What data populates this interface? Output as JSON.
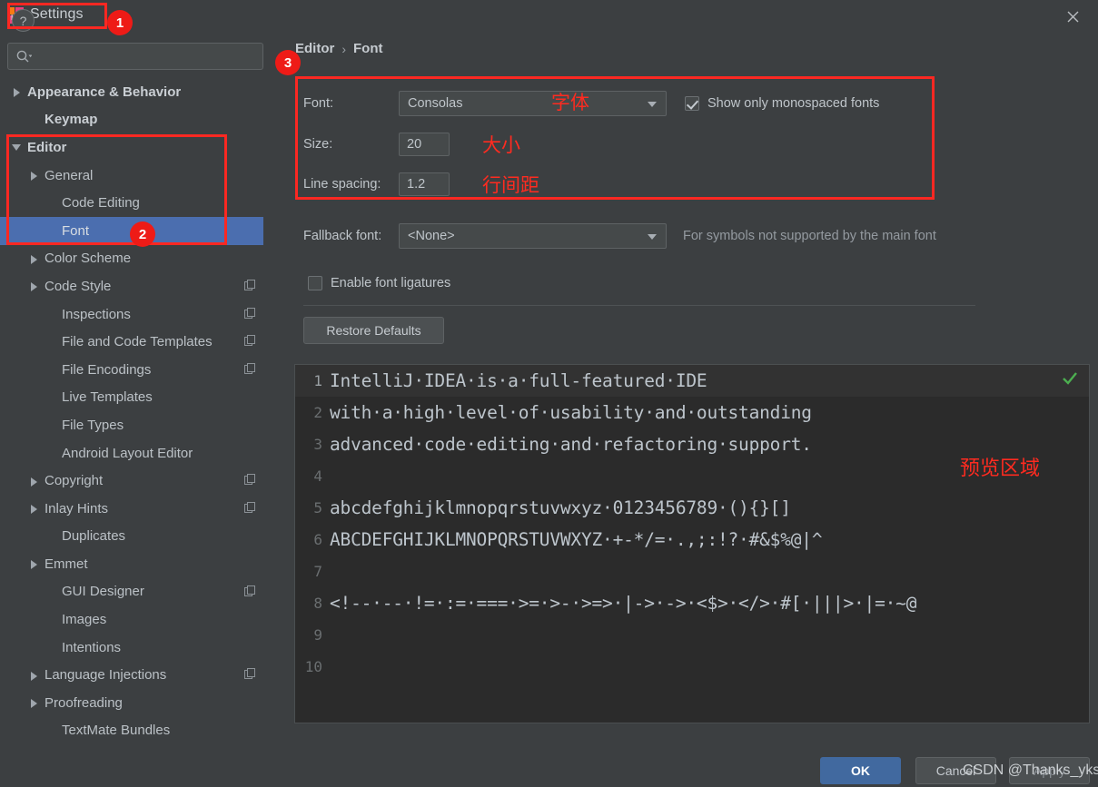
{
  "window": {
    "title": "Settings",
    "close_label": "✕",
    "app_icon": "intellij-idea-icon"
  },
  "search": {
    "placeholder": "",
    "value": "",
    "icon": "search-icon"
  },
  "sidebar": {
    "items": [
      {
        "label": "Appearance & Behavior",
        "indent": 0,
        "twisty": "right",
        "bold": true,
        "selected": false,
        "copyable": false
      },
      {
        "label": "Keymap",
        "indent": 1,
        "twisty": "none",
        "bold": true,
        "selected": false,
        "copyable": false
      },
      {
        "label": "Editor",
        "indent": 0,
        "twisty": "down",
        "bold": true,
        "selected": false,
        "copyable": false
      },
      {
        "label": "General",
        "indent": 1,
        "twisty": "right",
        "bold": false,
        "selected": false,
        "copyable": false
      },
      {
        "label": "Code Editing",
        "indent": 2,
        "twisty": "none",
        "bold": false,
        "selected": false,
        "copyable": false
      },
      {
        "label": "Font",
        "indent": 2,
        "twisty": "none",
        "bold": false,
        "selected": true,
        "copyable": false
      },
      {
        "label": "Color Scheme",
        "indent": 1,
        "twisty": "right",
        "bold": false,
        "selected": false,
        "copyable": false
      },
      {
        "label": "Code Style",
        "indent": 1,
        "twisty": "right",
        "bold": false,
        "selected": false,
        "copyable": true
      },
      {
        "label": "Inspections",
        "indent": 2,
        "twisty": "none",
        "bold": false,
        "selected": false,
        "copyable": true
      },
      {
        "label": "File and Code Templates",
        "indent": 2,
        "twisty": "none",
        "bold": false,
        "selected": false,
        "copyable": true
      },
      {
        "label": "File Encodings",
        "indent": 2,
        "twisty": "none",
        "bold": false,
        "selected": false,
        "copyable": true
      },
      {
        "label": "Live Templates",
        "indent": 2,
        "twisty": "none",
        "bold": false,
        "selected": false,
        "copyable": false
      },
      {
        "label": "File Types",
        "indent": 2,
        "twisty": "none",
        "bold": false,
        "selected": false,
        "copyable": false
      },
      {
        "label": "Android Layout Editor",
        "indent": 2,
        "twisty": "none",
        "bold": false,
        "selected": false,
        "copyable": false
      },
      {
        "label": "Copyright",
        "indent": 1,
        "twisty": "right",
        "bold": false,
        "selected": false,
        "copyable": true
      },
      {
        "label": "Inlay Hints",
        "indent": 1,
        "twisty": "right",
        "bold": false,
        "selected": false,
        "copyable": true
      },
      {
        "label": "Duplicates",
        "indent": 2,
        "twisty": "none",
        "bold": false,
        "selected": false,
        "copyable": false
      },
      {
        "label": "Emmet",
        "indent": 1,
        "twisty": "right",
        "bold": false,
        "selected": false,
        "copyable": false
      },
      {
        "label": "GUI Designer",
        "indent": 2,
        "twisty": "none",
        "bold": false,
        "selected": false,
        "copyable": true
      },
      {
        "label": "Images",
        "indent": 2,
        "twisty": "none",
        "bold": false,
        "selected": false,
        "copyable": false
      },
      {
        "label": "Intentions",
        "indent": 2,
        "twisty": "none",
        "bold": false,
        "selected": false,
        "copyable": false
      },
      {
        "label": "Language Injections",
        "indent": 1,
        "twisty": "right",
        "bold": false,
        "selected": false,
        "copyable": true
      },
      {
        "label": "Proofreading",
        "indent": 1,
        "twisty": "right",
        "bold": false,
        "selected": false,
        "copyable": false
      },
      {
        "label": "TextMate Bundles",
        "indent": 2,
        "twisty": "none",
        "bold": false,
        "selected": false,
        "copyable": false
      }
    ]
  },
  "breadcrumb": {
    "parent": "Editor",
    "separator": "›",
    "current": "Font"
  },
  "form": {
    "font_label": "Font:",
    "font_value": "Consolas",
    "font_annotation": "字体",
    "monospaced_label": "Show only monospaced fonts",
    "monospaced_checked": true,
    "size_label": "Size:",
    "size_value": "20",
    "size_annotation": "大小",
    "line_spacing_label": "Line spacing:",
    "line_spacing_value": "1.2",
    "line_spacing_annotation": "行间距",
    "fallback_label": "Fallback font:",
    "fallback_value": "<None>",
    "fallback_hint": "For symbols not supported by the main font",
    "ligatures_label": "Enable font ligatures",
    "ligatures_checked": false,
    "restore_label": "Restore Defaults"
  },
  "preview": {
    "annotation": "预览区域",
    "status_icon": "green-check-icon",
    "lines": [
      {
        "num": "1",
        "text": "IntelliJ·IDEA·is·a·full-featured·IDE"
      },
      {
        "num": "2",
        "text": "with·a·high·level·of·usability·and·outstanding"
      },
      {
        "num": "3",
        "text": "advanced·code·editing·and·refactoring·support."
      },
      {
        "num": "4",
        "text": ""
      },
      {
        "num": "5",
        "text": "abcdefghijklmnopqrstuvwxyz·0123456789·(){}[]"
      },
      {
        "num": "6",
        "text": "ABCDEFGHIJKLMNOPQRSTUVWXYZ·+-*/=·.,;:!?·#&$%@|^"
      },
      {
        "num": "7",
        "text": ""
      },
      {
        "num": "8",
        "text": "<!--·--·!=·:=·===·>=·>-·>=>·|->·->·<$>·</>·#[·|||>·|=·~@"
      },
      {
        "num": "9",
        "text": ""
      },
      {
        "num": "10",
        "text": ""
      }
    ]
  },
  "footer": {
    "help_label": "?",
    "ok_label": "OK",
    "cancel_label": "Cancel",
    "apply_label": "Apply",
    "watermark": "CSDN @Thanks_yks"
  },
  "annotations": {
    "badge1": "1",
    "badge2": "2",
    "badge3": "3"
  },
  "colors": {
    "accent_blue": "#4b6eaf",
    "annotation_red": "#fb2822",
    "panel_bg": "#3c3f41",
    "editor_bg": "#2b2b2b",
    "ok_button": "#41699f"
  }
}
